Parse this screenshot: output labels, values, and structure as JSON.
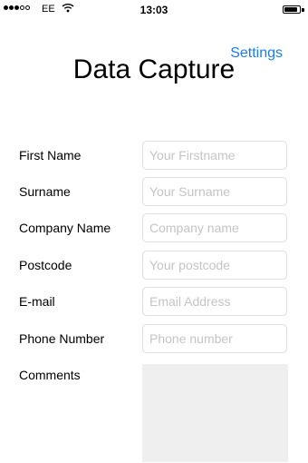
{
  "status_bar": {
    "signal_bars_filled": 3,
    "signal_bars_total": 5,
    "carrier": "EE",
    "time": "13:03",
    "battery_level": 0.85
  },
  "header": {
    "settings_label": "Settings",
    "title": "Data Capture"
  },
  "form": {
    "fields": [
      {
        "label": "First Name",
        "placeholder": "Your Firstname",
        "value": ""
      },
      {
        "label": "Surname",
        "placeholder": "Your Surname",
        "value": ""
      },
      {
        "label": "Company Name",
        "placeholder": "Company name",
        "value": ""
      },
      {
        "label": "Postcode",
        "placeholder": "Your postcode",
        "value": ""
      },
      {
        "label": "E-mail",
        "placeholder": "Email Address",
        "value": ""
      },
      {
        "label": "Phone Number",
        "placeholder": "Phone number",
        "value": ""
      }
    ],
    "comments": {
      "label": "Comments",
      "value": ""
    }
  },
  "colors": {
    "accent": "#1a7cf0",
    "placeholder": "#c4c4c4",
    "input_border": "#dedede",
    "comments_background": "#efefef"
  }
}
